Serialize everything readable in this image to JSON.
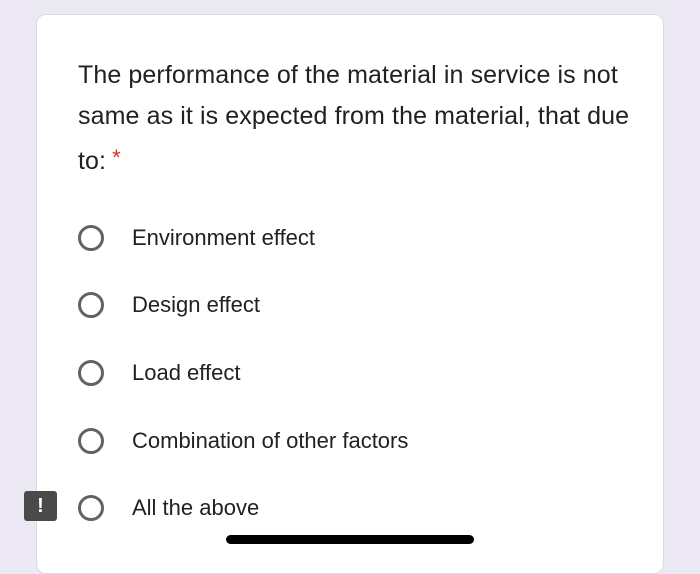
{
  "question": {
    "text": "The performance of the material in service is not same as it is expected from the material, that due to:",
    "required_mark": "*"
  },
  "options": [
    {
      "label": "Environment effect",
      "selected": false
    },
    {
      "label": "Design effect",
      "selected": false
    },
    {
      "label": "Load effect",
      "selected": false
    },
    {
      "label": "Combination of other factors",
      "selected": false
    },
    {
      "label": "All the above",
      "selected": false
    }
  ],
  "feedback_button": {
    "glyph": "!"
  },
  "colors": {
    "page_background": "#ece8f4",
    "card_background": "#ffffff",
    "text": "#202124",
    "radio_border": "#5f6368",
    "required": "#d93025"
  }
}
